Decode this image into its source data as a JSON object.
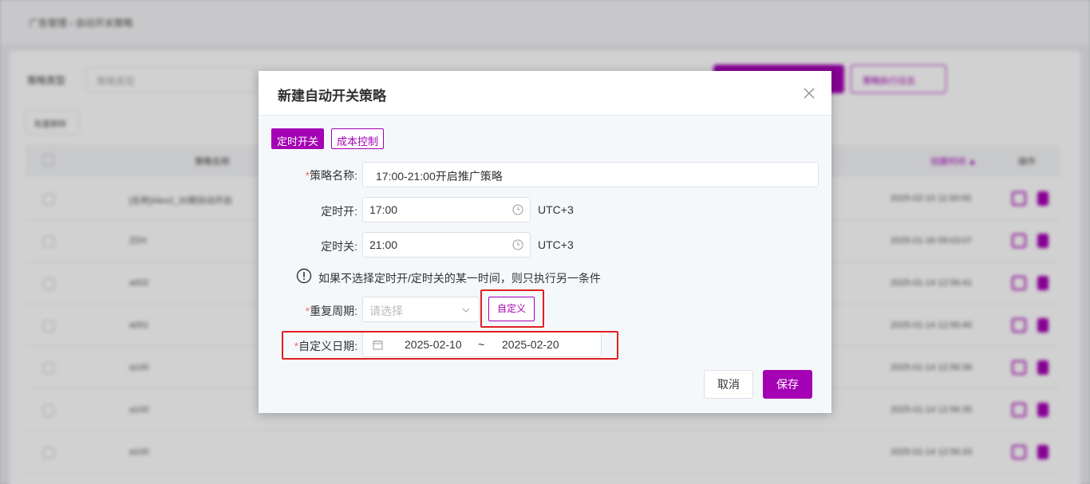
{
  "background": {
    "breadcrumb": "广告管理  ›  自动开关策略",
    "filter_label": "策略类型",
    "filter_placeholder": "策略类型",
    "primary_button": "",
    "secondary_button": "策略执行日志",
    "batch_button": "批量删除",
    "columns": [
      "策略名称",
      "创建时间 ▲",
      "操作"
    ],
    "rows": [
      {
        "name": "[名称]Alex2_30期自动开启",
        "time": "2025-02-10 11:00:00"
      },
      {
        "name": "ZDX",
        "time": "2025-01-16 09:03:07"
      },
      {
        "name": "a002",
        "time": "2025-01-14 12:56:41"
      },
      {
        "name": "a001",
        "time": "2025-01-14 12:56:40"
      },
      {
        "name": "a100",
        "time": "2025-01-14 12:56:39"
      },
      {
        "name": "a100",
        "time": "2025-01-14 12:56:35"
      },
      {
        "name": "a100",
        "time": "2025-01-14 12:56:33"
      }
    ]
  },
  "dialog": {
    "title": "新建自动开关策略",
    "tabs": [
      "定时开关",
      "成本控制"
    ],
    "required_mark": "*",
    "fields": {
      "name_label": "策略名称:",
      "name_value": "17:00-21:00开启推广策略",
      "on_label": "定时开:",
      "on_value": "17:00",
      "off_label": "定时关:",
      "off_value": "21:00",
      "timezone": "UTC+3",
      "tip": "如果不选择定时开/定时关的某一时间，则只执行另一条件",
      "repeat_label": "重复周期:",
      "repeat_placeholder": "请选择",
      "custom_button": "自定义",
      "custom_date_label": "自定义日期:",
      "date_start": "2025-02-10",
      "date_sep": "~",
      "date_end": "2025-02-20"
    },
    "buttons": {
      "cancel": "取消",
      "save": "保存"
    }
  },
  "colors": {
    "accent": "#a400b4",
    "highlight": "#e02020",
    "required": "#f56c6c"
  }
}
